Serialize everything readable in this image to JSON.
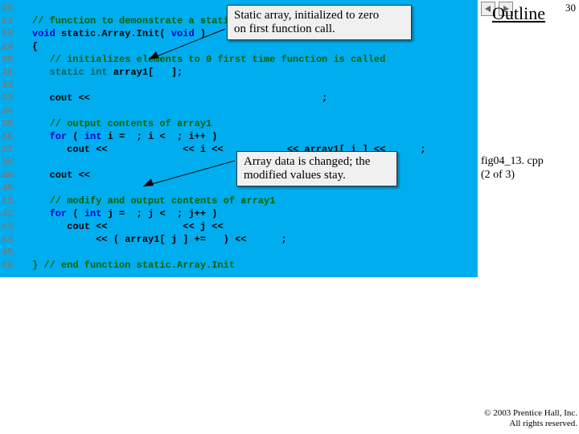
{
  "lineNumbers": [
    "26",
    "27",
    "28",
    "29",
    "30",
    "31",
    "32",
    "33",
    "34",
    "35",
    "36",
    "37",
    "38",
    "39",
    "40",
    "41",
    "42",
    "43",
    "44",
    "45",
    "46"
  ],
  "code": {
    "l26": "// function to demonstrate a static",
    "l27a": "void",
    "l27b": " static.Array.Init( ",
    "l27c": "void",
    "l27d": " )",
    "l28": "{",
    "l29": "   // initializes elements to 0 first time function is called",
    "l30a": "   static int",
    "l30b": " array1[   ];",
    "l32a": "   cout << ",
    "l32b": "                                       ;",
    "l34": "   // output contents of array1",
    "l35a": "   for",
    "l35b": " ( ",
    "l35c": "int",
    "l35d": " i =  ; i <  ; i++ )",
    "l36a": "      cout << ",
    "l36b": "            << i <<           << array1[ i ] <<      ;",
    "l38a": "   cout << ",
    "l40": "   // modify and output contents of array1",
    "l41a": "   for",
    "l41b": " ( ",
    "l41c": "int",
    "l41d": " j =  ; j <  ; j++ )",
    "l42a": "      cout << ",
    "l42b": "            << j << ",
    "l43": "           << ( array1[ j ] +=   ) <<      ;",
    "l45": "} // end function static.Array.Init"
  },
  "callout1": {
    "line1": "Static array, initialized to zero",
    "line2": "on first function call."
  },
  "callout2": {
    "line1": "Array data is changed; the",
    "line2": "modified values stay."
  },
  "right": {
    "outline": "Outline",
    "slideNum": "30",
    "figLine1": "fig04_13. cpp",
    "figLine2": "(2 of 3)"
  },
  "copyright": {
    "line1": "© 2003 Prentice Hall, Inc.",
    "line2": "All rights reserved."
  }
}
